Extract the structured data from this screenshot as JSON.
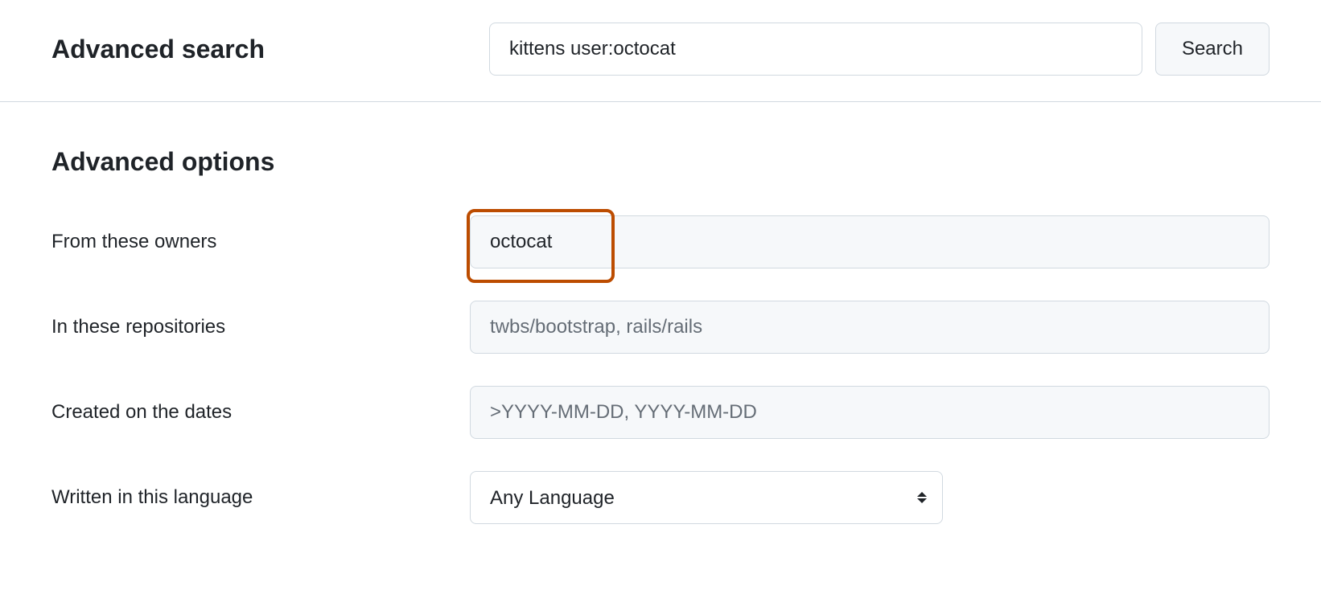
{
  "header": {
    "title": "Advanced search",
    "search_value": "kittens user:octocat",
    "search_button_label": "Search"
  },
  "options": {
    "title": "Advanced options",
    "fields": {
      "owners": {
        "label": "From these owners",
        "value": "octocat",
        "placeholder": ""
      },
      "repositories": {
        "label": "In these repositories",
        "value": "",
        "placeholder": "twbs/bootstrap, rails/rails"
      },
      "created": {
        "label": "Created on the dates",
        "value": "",
        "placeholder": ">YYYY-MM-DD, YYYY-MM-DD"
      },
      "language": {
        "label": "Written in this language",
        "selected": "Any Language"
      }
    }
  }
}
